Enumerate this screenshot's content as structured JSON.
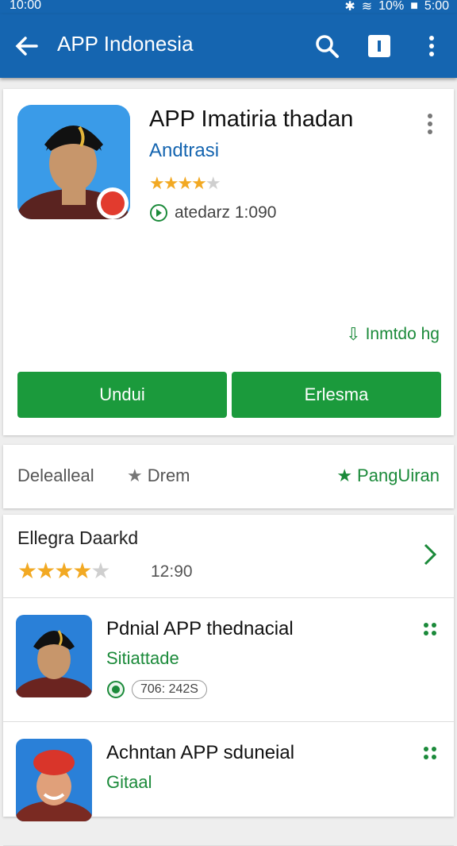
{
  "status": {
    "time_left": "10:00",
    "battery": "10%",
    "time_right": "5:00"
  },
  "appbar": {
    "title": "APP Indonesia",
    "icons": [
      "back-arrow-icon",
      "search-icon",
      "info-icon",
      "more-vert-icon"
    ]
  },
  "hero": {
    "name": "APP Imatiria thadan",
    "developer": "Andtrasi",
    "rating": 3.5,
    "meta": "atedarz 1:090",
    "install_link": "Inmtdo hg",
    "primary_button": "Undui",
    "secondary_button": "Erlesma",
    "accent": "#1b9a3c"
  },
  "tabs": {
    "t1": "Delealleal",
    "t2": "Drem",
    "t3": "PangUiran"
  },
  "rating_row": {
    "label": "Ellegra Daarkd",
    "rating": 4,
    "number": "12:90"
  },
  "apps": [
    {
      "title": "Pdnial APP thednacial",
      "subtitle": "Sitiattade",
      "pill": "706: 242S"
    },
    {
      "title": "Achntan APP sduneial",
      "subtitle": "Gitaal"
    }
  ],
  "colors": {
    "bar": "#1565b0",
    "green": "#1b8a3a"
  }
}
